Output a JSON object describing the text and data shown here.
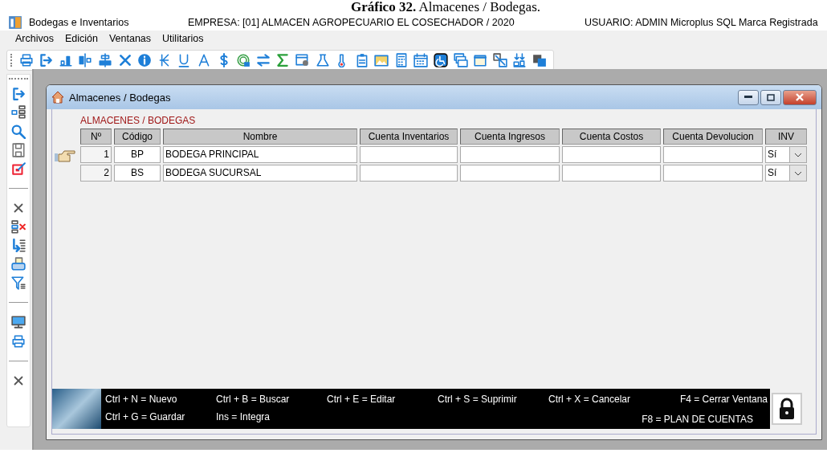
{
  "caption": "**Gráfico 32.** Almacenes / Bodegas.",
  "app": {
    "title": "Bodegas e Inventarios",
    "company": "EMPRESA:  [01] ALMACEN AGROPECUARIO EL COSECHADOR / 2020",
    "user": "USUARIO: ADMIN  Microplus SQL Marca Registrada"
  },
  "menu": [
    "Archivos",
    "Edición",
    "Ventanas",
    "Utilitarios"
  ],
  "child_window": {
    "title": "Almacenes / Bodegas",
    "section_label": "ALMACENES / BODEGAS",
    "table": {
      "columns": [
        "Nº",
        "Código",
        "Nombre",
        "Cuenta Inventarios",
        "Cuenta Ingresos",
        "Cuenta Costos",
        "Cuenta Devolucion",
        "INV"
      ],
      "rows": [
        {
          "selected": true,
          "no": "1",
          "code": "BP",
          "name": "BODEGA PRINCIPAL",
          "inv": "Sí"
        },
        {
          "selected": false,
          "no": "2",
          "code": "BS",
          "name": "BODEGA SUCURSAL",
          "inv": "Sí"
        }
      ]
    },
    "shortcuts": {
      "rows": [
        [
          "Ctrl + N = Nuevo",
          "Ctrl + B = Buscar",
          "Ctrl + E = Editar",
          "Ctrl + S = Suprimir",
          "Ctrl + X = Cancelar",
          "F4 = Cerrar  Ventana"
        ],
        [
          "Ctrl + G = Guardar",
          "Ins = Integra"
        ]
      ],
      "aside": "F8 = PLAN DE CUENTAS"
    }
  }
}
